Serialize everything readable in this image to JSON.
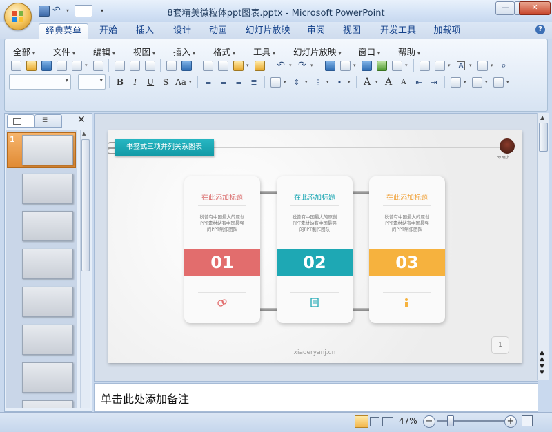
{
  "window": {
    "title": "8套精美微粒体ppt图表.pptx - Microsoft PowerPoint",
    "minimize": "—",
    "maximize": "▢",
    "close": "✕"
  },
  "tabs": [
    "经典菜单",
    "开始",
    "插入",
    "设计",
    "动画",
    "幻灯片放映",
    "审阅",
    "视图",
    "开发工具",
    "加载项"
  ],
  "help": "?",
  "menus": [
    "全部",
    "文件",
    "编辑",
    "视图",
    "插入",
    "格式",
    "工具",
    "幻灯片放映",
    "窗口",
    "帮助"
  ],
  "format_buttons": {
    "bold": "B",
    "italic": "I",
    "underline": "U",
    "shadow": "S",
    "case": "Aa"
  },
  "font_size_buttons": {
    "grow": "A",
    "shrink": "A"
  },
  "text_box_button": "A",
  "slide_panel": {
    "current_slide_number": "1",
    "thumbnail_count": 8
  },
  "slide": {
    "header_label": "书签式三项并列关系图表",
    "logo_caption": "by 晓小二",
    "cards": [
      {
        "title": "在此添加标题",
        "desc": "锐普有中国最大的原创PPT素材站有中国最强的PPT制作团队",
        "number": "01",
        "color": "#e26d6d",
        "title_color": "#d96b6b",
        "icon": "people-icon"
      },
      {
        "title": "在此添加标题",
        "desc": "锐普有中国最大的原创PPT素材站有中国最强的PPT制作团队",
        "number": "02",
        "color": "#1ea8b4",
        "title_color": "#1ea8b4",
        "icon": "document-icon"
      },
      {
        "title": "在此添加标题",
        "desc": "锐普有中国最大的原创PPT素材站有中国最强的PPT制作团队",
        "number": "03",
        "color": "#f6b23e",
        "title_color": "#f0a23a",
        "icon": "person-icon"
      }
    ],
    "footer_site": "xiaoeryanj.cn",
    "page_number": "1"
  },
  "notes": {
    "placeholder": "单击此处添加备注"
  },
  "status": {
    "zoom": "47%",
    "zoom_out": "−",
    "zoom_in": "+"
  }
}
